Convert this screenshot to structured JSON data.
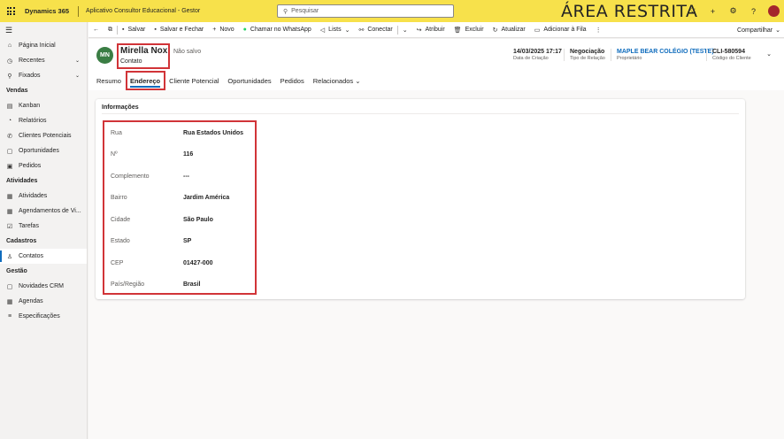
{
  "topbar": {
    "brand": "Dynamics 365",
    "app_title": "Aplicativo Consultor Educacional - Gestor",
    "search_placeholder": "Pesquisar",
    "restricted_label": "ÁREA RESTRITA",
    "icons": [
      "lightbulb-icon",
      "plus-icon",
      "gear-icon",
      "help-icon",
      "user-avatar"
    ]
  },
  "sidebar": {
    "items_top": [
      {
        "label": "Página Inicial",
        "icon": "home-icon"
      },
      {
        "label": "Recentes",
        "icon": "clock-icon",
        "chevron": true
      },
      {
        "label": "Fixados",
        "icon": "pin-icon",
        "chevron": true
      }
    ],
    "sections": [
      {
        "title": "Vendas",
        "items": [
          "Kanban",
          "Relatórios",
          "Clientes Potenciais",
          "Oportunidades",
          "Pedidos"
        ]
      },
      {
        "title": "Atividades",
        "items": [
          "Atividades",
          "Agendamentos de Vi...",
          "Tarefas"
        ]
      },
      {
        "title": "Cadastros",
        "items": [
          "Contatos"
        ]
      },
      {
        "title": "Gestão",
        "items": [
          "Novidades CRM",
          "Agendas",
          "Especificações"
        ]
      }
    ]
  },
  "commandbar": {
    "save": "Salvar",
    "save_close": "Salvar e Fechar",
    "new": "Novo",
    "whatsapp": "Chamar no WhatsApp",
    "lists": "Lists",
    "connect": "Conectar",
    "assign": "Atribuir",
    "delete": "Excluir",
    "refresh": "Atualizar",
    "add_queue": "Adicionar à Fila",
    "share": "Compartilhar"
  },
  "record": {
    "initials": "MN",
    "name": "Mirella Nox",
    "type": "Contato",
    "status": "Não salvo",
    "header_fields": [
      {
        "value": "14/03/2025 17:17",
        "label": "Data de Criação"
      },
      {
        "value": "Negociação",
        "label": "Tipo de Relação"
      },
      {
        "value": "MAPLE BEAR COLÉGIO (TESTE)",
        "label": "Proprietário"
      },
      {
        "value": "CLI-580594",
        "label": "Código do Cliente"
      }
    ],
    "tabs": [
      "Resumo",
      "Endereço",
      "Cliente Potencial",
      "Oportunidades",
      "Pedidos",
      "Relacionados"
    ]
  },
  "section": {
    "title": "Informações",
    "fields": [
      {
        "label": "Rua",
        "value": "Rua Estados Unidos"
      },
      {
        "label": "Nº",
        "value": "116"
      },
      {
        "label": "Complemento",
        "value": "---"
      },
      {
        "label": "Bairro",
        "value": "Jardim América"
      },
      {
        "label": "Cidade",
        "value": "São Paulo"
      },
      {
        "label": "Estado",
        "value": "SP"
      },
      {
        "label": "CEP",
        "value": "01427-000"
      },
      {
        "label": "País/Região",
        "value": "Brasil"
      }
    ]
  },
  "colors": {
    "topbar": "#f7e14b",
    "accent": "#0f6cbd",
    "highlight": "#d13438",
    "avatar": "#3a7d44"
  }
}
